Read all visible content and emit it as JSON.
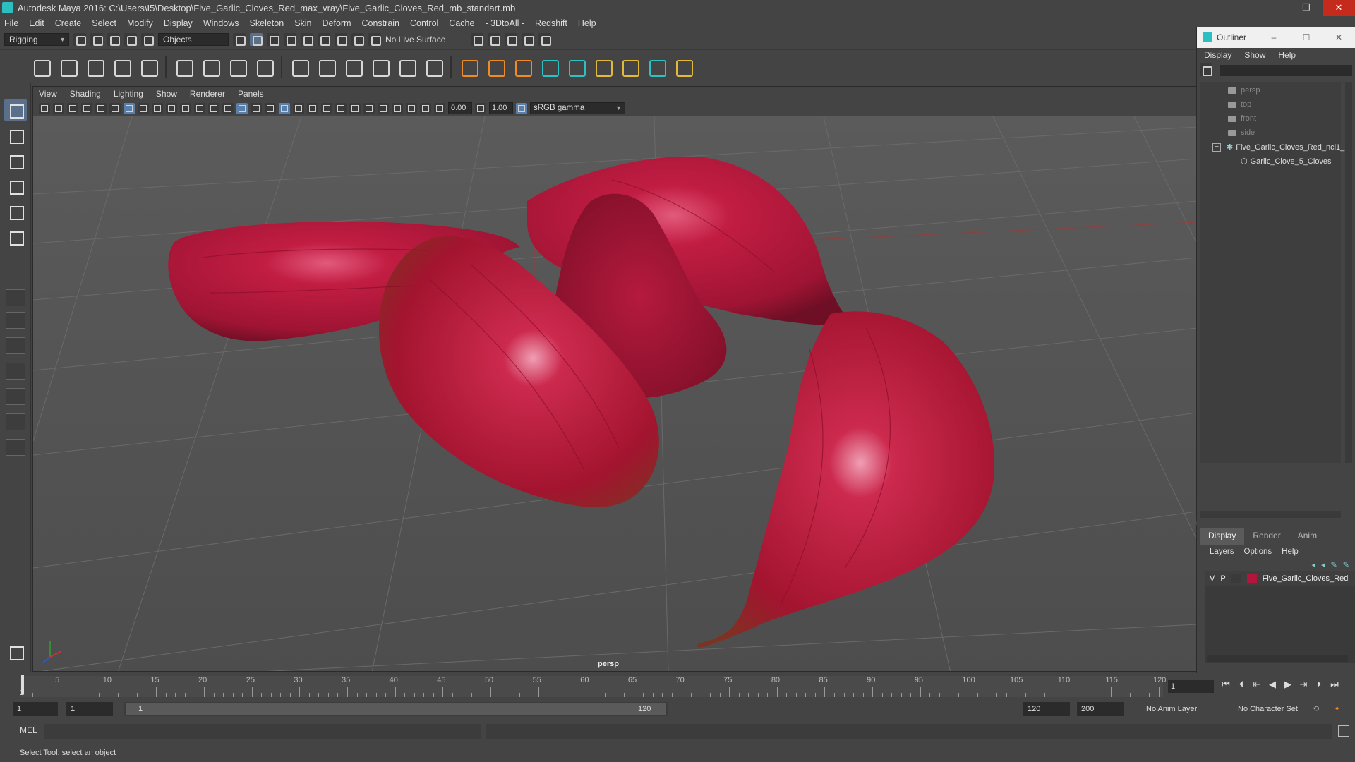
{
  "window": {
    "title": "Autodesk Maya 2016: C:\\Users\\I5\\Desktop\\Five_Garlic_Cloves_Red_max_vray\\Five_Garlic_Cloves_Red_mb_standart.mb",
    "minimize": "–",
    "restore": "❐",
    "close": "✕"
  },
  "menus": [
    "File",
    "Edit",
    "Create",
    "Select",
    "Modify",
    "Display",
    "Windows",
    "Skeleton",
    "Skin",
    "Deform",
    "Constrain",
    "Control",
    "Cache",
    "- 3DtoAll -",
    "Redshift",
    "Help"
  ],
  "statusline": {
    "menuset": "Rigging",
    "select_mode": "Objects",
    "live_surface": "No Live Surface"
  },
  "viewport": {
    "menus": [
      "View",
      "Shading",
      "Lighting",
      "Show",
      "Renderer",
      "Panels"
    ],
    "exposure": "0.00",
    "gamma_value": "1.00",
    "color_space": "sRGB gamma",
    "camera_label": "persp"
  },
  "outliner": {
    "title": "Outliner",
    "menus": [
      "Display",
      "Show",
      "Help"
    ],
    "items": [
      {
        "label": "persp",
        "type": "camera"
      },
      {
        "label": "top",
        "type": "camera"
      },
      {
        "label": "front",
        "type": "camera"
      },
      {
        "label": "side",
        "type": "camera"
      },
      {
        "label": "Five_Garlic_Cloves_Red_ncl1_",
        "type": "group"
      },
      {
        "label": "Garlic_Clove_5_Cloves",
        "type": "mesh"
      }
    ]
  },
  "layers": {
    "tabs": [
      "Display",
      "Render",
      "Anim"
    ],
    "menus": [
      "Layers",
      "Options",
      "Help"
    ],
    "row": {
      "v": "V",
      "p": "P",
      "name": "Five_Garlic_Cloves_Red",
      "color": "#b2163c"
    }
  },
  "timeline": {
    "ticks": [
      "5",
      "10",
      "15",
      "20",
      "25",
      "30",
      "35",
      "40",
      "45",
      "50",
      "55",
      "60",
      "65",
      "70",
      "75",
      "80",
      "85",
      "90",
      "95",
      "100",
      "105",
      "110",
      "115",
      "120"
    ],
    "current_frame": "1",
    "start_label": "1"
  },
  "range": {
    "start": "1",
    "inner_start": "1",
    "slider_start": "1",
    "slider_end": "120",
    "end": "120",
    "max": "200",
    "anim_layer": "No Anim Layer",
    "char_set": "No Character Set"
  },
  "mel": {
    "label": "MEL"
  },
  "help": "Select Tool: select an object",
  "colors": {
    "garlic": "#b5183a",
    "garlic_dark": "#6a0d22",
    "grid": "#6e6e6e"
  }
}
